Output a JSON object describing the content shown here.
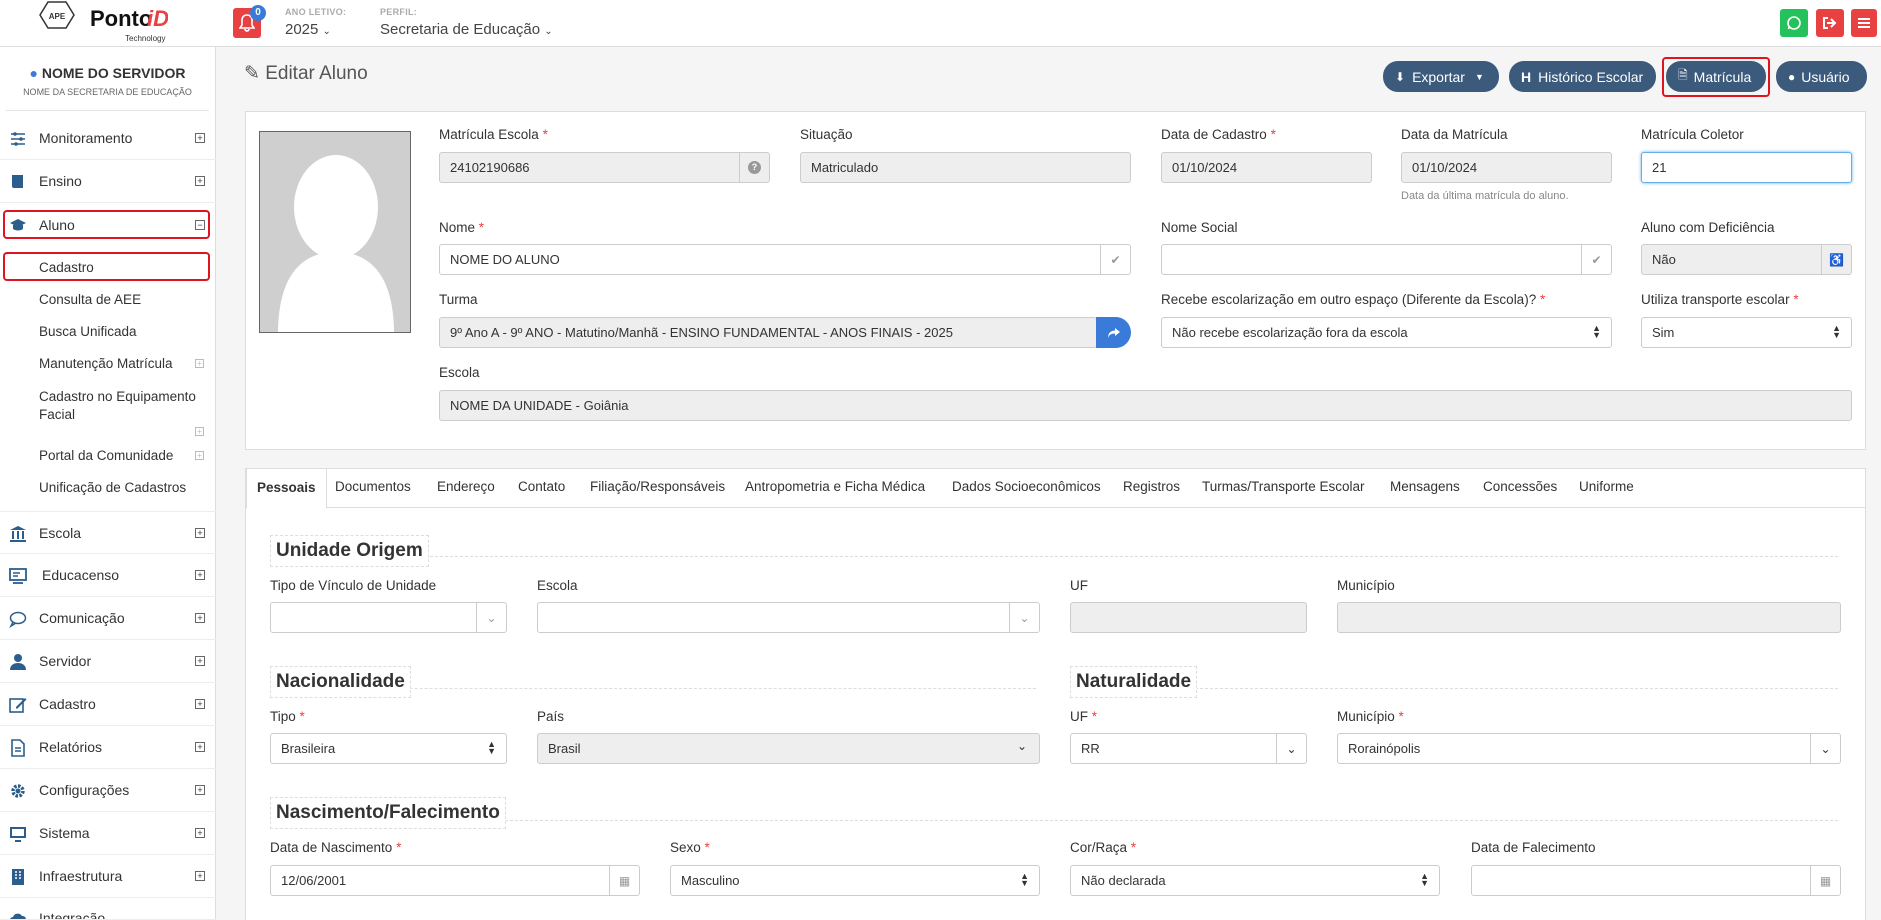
{
  "topbar": {
    "logo_text": "PontoiD",
    "logo_sub": "Technology",
    "notification_count": "0",
    "ano_letivo_label": "ANO LETIVO:",
    "ano_letivo_value": "2025",
    "perfil_label": "PERFIL:",
    "perfil_value": "Secretaria de Educação",
    "colors": {
      "whatsapp": "#25c15c",
      "logout": "#e84142",
      "menu": "#e84142",
      "bell": "#e84142"
    }
  },
  "sidebar": {
    "user_name": "NOME DO SERVIDOR",
    "user_sub": "NOME DA SECRETARIA DE EDUCAÇÃO",
    "items": [
      {
        "label": "Monitoramento",
        "icon": "sliders-icon"
      },
      {
        "label": "Ensino",
        "icon": "book-icon"
      },
      {
        "label": "Aluno",
        "icon": "graduation-cap-icon"
      },
      {
        "label": "Escola",
        "icon": "bank-icon"
      },
      {
        "label": "Educacenso",
        "icon": "chalkboard-icon"
      },
      {
        "label": "Comunicação",
        "icon": "chat-icon"
      },
      {
        "label": "Servidor",
        "icon": "user-icon"
      },
      {
        "label": "Cadastro",
        "icon": "edit-icon"
      },
      {
        "label": "Relatórios",
        "icon": "file-icon"
      },
      {
        "label": "Configurações",
        "icon": "gear-icon"
      },
      {
        "label": "Sistema",
        "icon": "monitor-icon"
      },
      {
        "label": "Infraestrutura",
        "icon": "building-icon"
      },
      {
        "label": "Integração",
        "icon": "cloud-icon"
      }
    ],
    "aluno_subitems": [
      "Cadastro",
      "Consulta de AEE",
      "Busca Unificada",
      "Manutenção Matrícula",
      "Cadastro no Equipamento Facial",
      "Portal da Comunidade",
      "Unificação de Cadastros"
    ]
  },
  "header": {
    "title": "Editar Aluno",
    "buttons": {
      "exportar": "Exportar",
      "historico": "Histórico Escolar",
      "matricula": "Matrícula",
      "usuario": "Usuário"
    }
  },
  "form": {
    "matricula_escola": {
      "label": "Matrícula Escola",
      "value": "24102190686"
    },
    "situacao": {
      "label": "Situação",
      "value": "Matriculado"
    },
    "data_cadastro": {
      "label": "Data de Cadastro",
      "value": "01/10/2024"
    },
    "data_matricula": {
      "label": "Data da Matrícula",
      "value": "01/10/2024",
      "hint": "Data da última matrícula do aluno."
    },
    "matricula_coletor": {
      "label": "Matrícula Coletor",
      "value": "21"
    },
    "nome": {
      "label": "Nome",
      "value": "NOME DO ALUNO"
    },
    "nome_social": {
      "label": "Nome Social",
      "value": ""
    },
    "deficiencia": {
      "label": "Aluno com Deficiência",
      "value": "Não"
    },
    "turma": {
      "label": "Turma",
      "value": "9º Ano A - 9º ANO - Matutino/Manhã - ENSINO FUNDAMENTAL - ANOS FINAIS - 2025"
    },
    "escolarizacao": {
      "label": "Recebe escolarização em outro espaço (Diferente da Escola)?",
      "value": "Não recebe escolarização fora da escola"
    },
    "transporte": {
      "label": "Utiliza transporte escolar",
      "value": "Sim"
    },
    "escola": {
      "label": "Escola",
      "value": "NOME DA UNIDADE - Goiânia"
    }
  },
  "tabs": [
    "Pessoais",
    "Documentos",
    "Endereço",
    "Contato",
    "Filiação/Responsáveis",
    "Antropometria e Ficha Médica",
    "Dados Socioeconômicos",
    "Registros",
    "Turmas/Transporte Escolar",
    "Mensagens",
    "Concessões",
    "Uniforme"
  ],
  "pessoais": {
    "unidade_origem": {
      "title": "Unidade Origem",
      "tipo_vinculo_label": "Tipo de Vínculo de Unidade",
      "escola_label": "Escola",
      "uf_label": "UF",
      "municipio_label": "Município"
    },
    "nacionalidade": {
      "title": "Nacionalidade",
      "tipo_label": "Tipo",
      "tipo_value": "Brasileira",
      "pais_label": "País",
      "pais_value": "Brasil"
    },
    "naturalidade": {
      "title": "Naturalidade",
      "uf_label": "UF",
      "uf_value": "RR",
      "municipio_label": "Município",
      "municipio_value": "Rorainópolis"
    },
    "nascimento": {
      "title": "Nascimento/Falecimento",
      "data_nasc_label": "Data de Nascimento",
      "data_nasc_value": "12/06/2001",
      "sexo_label": "Sexo",
      "sexo_value": "Masculino",
      "cor_label": "Cor/Raça",
      "cor_value": "Não declarada",
      "falecimento_label": "Data de Falecimento",
      "falecimento_value": ""
    }
  }
}
